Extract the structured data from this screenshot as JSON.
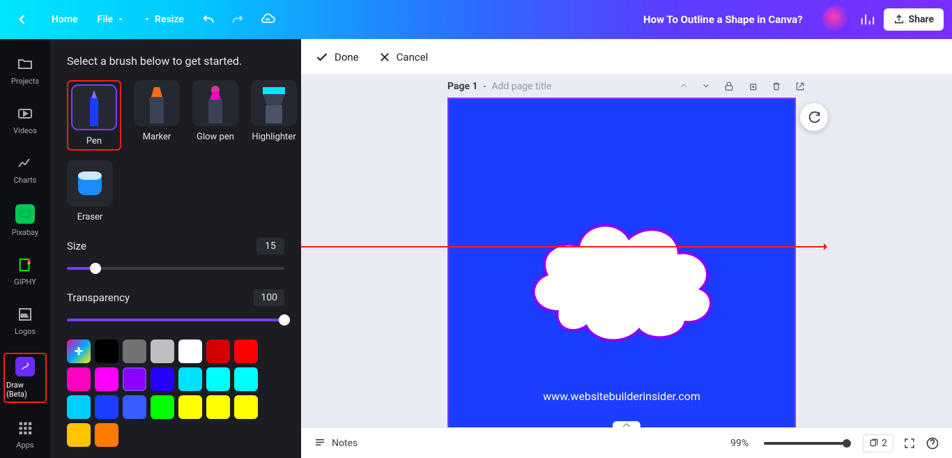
{
  "header": {
    "home": "Home",
    "file": "File",
    "resize": "Resize",
    "title": "How To Outline a Shape in Canva?",
    "share": "Share"
  },
  "rail": {
    "items": [
      {
        "label": "Projects",
        "icon": "folder-icon"
      },
      {
        "label": "Videos",
        "icon": "video-icon"
      },
      {
        "label": "Charts",
        "icon": "chart-line-icon"
      },
      {
        "label": "Pixabay",
        "icon": "pixabay-icon"
      },
      {
        "label": "GIPHY",
        "icon": "giphy-icon"
      },
      {
        "label": "Logos",
        "icon": "logos-icon"
      },
      {
        "label": "Draw (Beta)",
        "icon": "draw-icon"
      },
      {
        "label": "Apps",
        "icon": "apps-icon"
      }
    ]
  },
  "panel": {
    "heading": "Select a brush below to get started.",
    "brushes": [
      {
        "label": "Pen"
      },
      {
        "label": "Marker"
      },
      {
        "label": "Glow pen"
      },
      {
        "label": "Highlighter"
      },
      {
        "label": "Eraser"
      }
    ],
    "size": {
      "label": "Size",
      "value": "15",
      "percent": 13
    },
    "transparency": {
      "label": "Transparency",
      "value": "100",
      "percent": 100
    },
    "colors": [
      "add",
      "#000000",
      "#737373",
      "#bfbfbf",
      "#ffffff",
      "#d40000",
      "#ff0000",
      "#ff00c3",
      "#ff00ff",
      "#8b00ff",
      "#2600ff",
      "#00e1ff",
      "#00ffff",
      "#00ffff",
      "#00cfff",
      "#1a3dff",
      "#3a5dff",
      "#00ff00",
      "#ffff00",
      "#ffff00",
      "#ffff00",
      "#ffc400",
      "#ff7b00"
    ],
    "selected_color_index": 9
  },
  "canvas_tb": {
    "done": "Done",
    "cancel": "Cancel"
  },
  "page": {
    "label": "Page 1",
    "dash": " - ",
    "placeholder": "Add page title",
    "url": "www.websitebuilderinsider.com"
  },
  "bottom": {
    "notes": "Notes",
    "zoom": "99%",
    "zoom_percent": 99,
    "page_count": "2"
  }
}
